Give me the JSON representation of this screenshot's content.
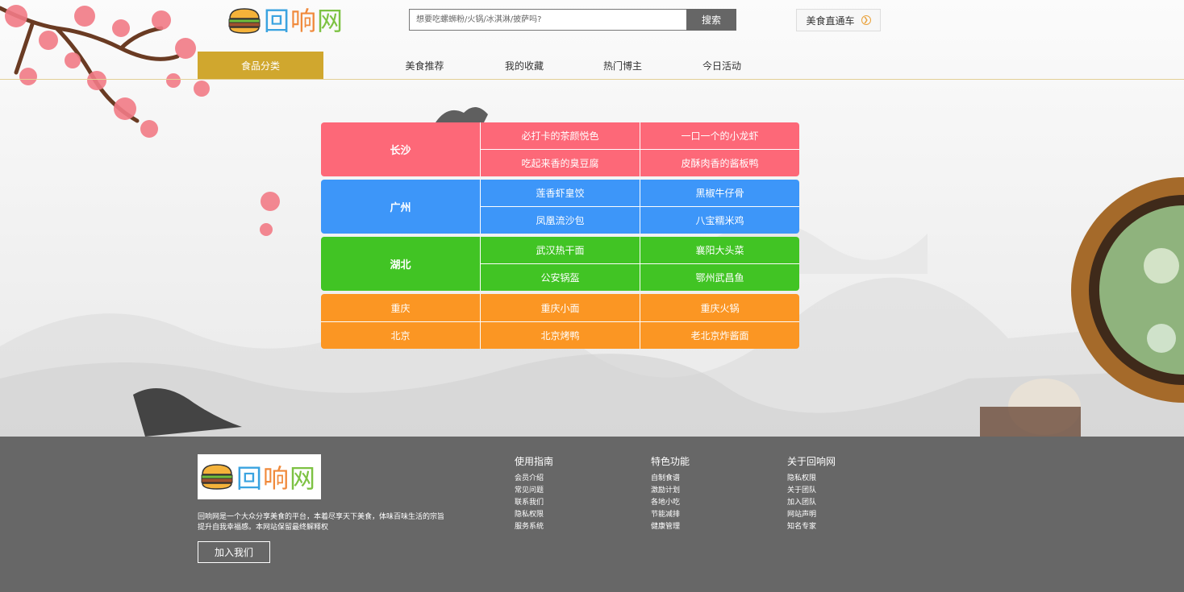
{
  "brand": {
    "logo_text": [
      "回",
      "响",
      "网"
    ]
  },
  "search": {
    "placeholder": "想要吃螺蛳粉/火锅/冰淇淋/披萨吗?",
    "button_label": "搜索"
  },
  "cart": {
    "label": "美食直通车",
    "icon": "chevron-right-circle-icon"
  },
  "nav": {
    "items": [
      {
        "label": "食品分类",
        "active": true
      },
      {
        "label": "美食推荐"
      },
      {
        "label": "我的收藏"
      },
      {
        "label": "热门博主"
      },
      {
        "label": "今日活动"
      }
    ]
  },
  "categories": [
    {
      "city": "长沙",
      "color": "#fd6878",
      "foods": [
        "必打卡的茶颜悦色",
        "一口一个的小龙虾",
        "吃起来香的臭豆腐",
        "皮酥肉香的酱板鸭"
      ]
    },
    {
      "city": "广州",
      "color": "#3d96f9",
      "foods": [
        "莲香虾皇饺",
        "黑椒牛仔骨",
        "凤凰流沙包",
        "八宝糯米鸡"
      ]
    },
    {
      "city": "湖北",
      "color": "#41c424",
      "foods": [
        "武汉热干面",
        "襄阳大头菜",
        "公安锅盔",
        "鄂州武昌鱼"
      ]
    },
    {
      "city": "重庆",
      "color": "#fb9623",
      "foods": [
        "重庆小面",
        "重庆火锅"
      ]
    },
    {
      "city": "北京",
      "color": "#fb9623",
      "foods": [
        "北京烤鸭",
        "老北京炸酱面"
      ]
    }
  ],
  "footer": {
    "description_line1": "回响网是一个大众分享美食的平台，本着尽享天下美食，体味百味生活的宗旨",
    "description_line2": "提升自我幸福感。本网站保留最终解释权",
    "join_label": "加入我们",
    "columns": [
      {
        "title": "使用指南",
        "links": [
          "会员介绍",
          "常见问题",
          "联系我们",
          "隐私权限",
          "服务系统"
        ]
      },
      {
        "title": "特色功能",
        "links": [
          "自制食谱",
          "激励计划",
          "各地小吃",
          "节能减排",
          "健康管理"
        ]
      },
      {
        "title": "关于回响网",
        "links": [
          "隐私权限",
          "关于团队",
          "加入团队",
          "网站声明",
          "知名专家"
        ]
      }
    ],
    "background": "#676767"
  },
  "colors": {
    "accent": "#d0a72e",
    "pink": "#fd6878",
    "blue": "#3d96f9",
    "green": "#41c424",
    "orange": "#fb9623"
  }
}
